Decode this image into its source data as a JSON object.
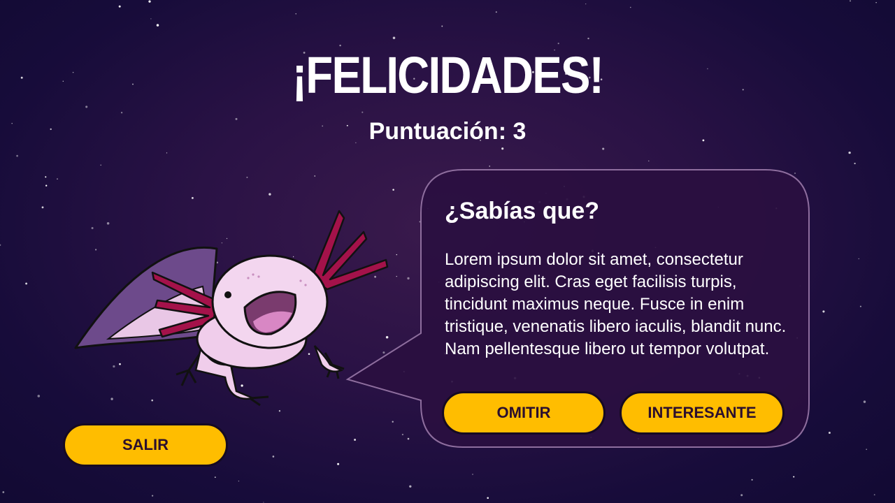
{
  "header": {
    "title": "¡FELICIDADES!",
    "score_text": "Puntuación: 3"
  },
  "fact_card": {
    "heading": "¿Sabías que?",
    "body": "Lorem ipsum dolor sit amet, consectetur adipiscing elit. Cras eget facilisis turpis, tincidunt maximus neque. Fusce in enim tristique, venenatis libero iaculis, blandit nunc. Nam pellentesque libero ut tempor volutpat."
  },
  "buttons": {
    "skip_label": "OMITIR",
    "interesting_label": "INTERESANTE",
    "exit_label": "SALIR"
  },
  "colors": {
    "button_fill": "#ffbd00",
    "bubble_fill": "#2a0f40",
    "bubble_border": "#8e6e9e",
    "axolotl_gills": "#a4124a",
    "axolotl_body": "#f0cdeb"
  },
  "icons": {
    "mascot": "axolotl-mascot-icon"
  }
}
